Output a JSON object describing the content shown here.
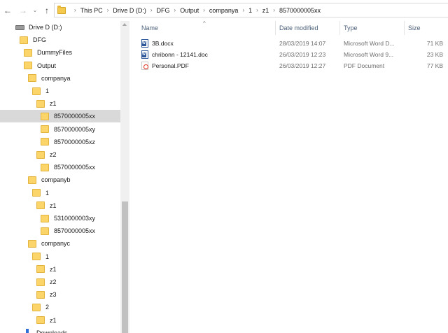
{
  "toolbar": {
    "back_icon": "arrow-left-icon",
    "forward_icon": "arrow-right-icon",
    "recent_icon": "chevron-down-icon",
    "up_icon": "arrow-up-icon",
    "back_glyph": "←",
    "forward_glyph": "→",
    "recent_glyph": "⌄",
    "up_glyph": "↑"
  },
  "address": {
    "separator": "›",
    "crumbs": [
      "This PC",
      "Drive D (D:)",
      "DFG",
      "Output",
      "companya",
      "1",
      "z1",
      "8570000005xx"
    ]
  },
  "tree": [
    {
      "label": "Drive D (D:)",
      "icon": "drive-icon",
      "indent": 0
    },
    {
      "label": "DFG",
      "icon": "folder-icon",
      "indent": 1
    },
    {
      "label": "DummyFiles",
      "icon": "folder-icon",
      "indent": 2
    },
    {
      "label": "Output",
      "icon": "folder-icon",
      "indent": 2
    },
    {
      "label": "companya",
      "icon": "folder-icon",
      "indent": 3
    },
    {
      "label": "1",
      "icon": "folder-icon",
      "indent": 4
    },
    {
      "label": "z1",
      "icon": "folder-icon",
      "indent": 5
    },
    {
      "label": "8570000005xx",
      "icon": "folder-icon",
      "indent": 6,
      "selected": true
    },
    {
      "label": "8570000005xy",
      "icon": "folder-icon",
      "indent": 6
    },
    {
      "label": "8570000005xz",
      "icon": "folder-icon",
      "indent": 6
    },
    {
      "label": "z2",
      "icon": "folder-icon",
      "indent": 5
    },
    {
      "label": "8570000005xx",
      "icon": "folder-icon",
      "indent": 6
    },
    {
      "label": "companyb",
      "icon": "folder-icon",
      "indent": 3
    },
    {
      "label": "1",
      "icon": "folder-icon",
      "indent": 4
    },
    {
      "label": "z1",
      "icon": "folder-icon",
      "indent": 5
    },
    {
      "label": "5310000003xy",
      "icon": "folder-icon",
      "indent": 6
    },
    {
      "label": "8570000005xx",
      "icon": "folder-icon",
      "indent": 6
    },
    {
      "label": "companyc",
      "icon": "folder-icon",
      "indent": 3
    },
    {
      "label": "1",
      "icon": "folder-icon",
      "indent": 4
    },
    {
      "label": "z1",
      "icon": "folder-icon",
      "indent": 5
    },
    {
      "label": "z2",
      "icon": "folder-icon",
      "indent": 5
    },
    {
      "label": "z3",
      "icon": "folder-icon",
      "indent": 5
    },
    {
      "label": "2",
      "icon": "folder-icon",
      "indent": 4
    },
    {
      "label": "z1",
      "icon": "folder-icon",
      "indent": 5
    },
    {
      "label": "Downloads",
      "icon": "download-icon",
      "indent": 2
    }
  ],
  "columns": {
    "name": "Name",
    "date": "Date modified",
    "type": "Type",
    "size": "Size",
    "sort_glyph": "^"
  },
  "files": [
    {
      "name": "3B.docx",
      "icon": "word-document-icon",
      "date": "28/03/2019 14:07",
      "type": "Microsoft Word D...",
      "size": "71 KB"
    },
    {
      "name": "chribonn - 12141.doc",
      "icon": "word-document-icon",
      "date": "26/03/2019 12:23",
      "type": "Microsoft Word 9...",
      "size": "23 KB"
    },
    {
      "name": "Personal.PDF",
      "icon": "pdf-document-icon",
      "date": "26/03/2019 12:27",
      "type": "PDF Document",
      "size": "77 KB"
    }
  ],
  "colors": {
    "selection": "#d9d9d9",
    "folder": "#fbd56a",
    "header_text": "#4c607a",
    "word_blue": "#2b579a",
    "pdf_red": "#e0321e"
  }
}
